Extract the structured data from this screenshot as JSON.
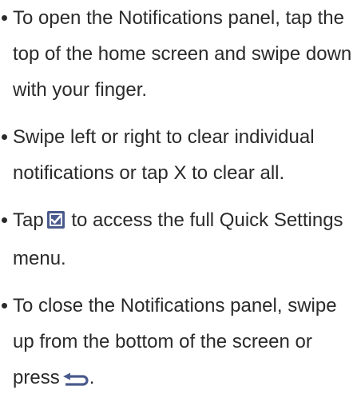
{
  "bullets": [
    {
      "lines": [
        "To open the Notifications panel, tap the",
        "top of the home screen and swipe down",
        "with your finger."
      ]
    },
    {
      "lines": [
        "Swipe left or right to clear individual",
        "notifications or tap X to clear all."
      ]
    },
    {
      "line1_before_icon": "Tap",
      "icon": "quick-settings-checkbox-icon",
      "line1_after_icon": "to access the full Quick Settings",
      "line2": "menu."
    },
    {
      "lines": [
        "To close the Notifications panel, swipe",
        "up from the bottom of the screen or"
      ],
      "line3_before_icon": "press",
      "icon": "back-arrow-icon",
      "line3_after_icon": "."
    }
  ]
}
